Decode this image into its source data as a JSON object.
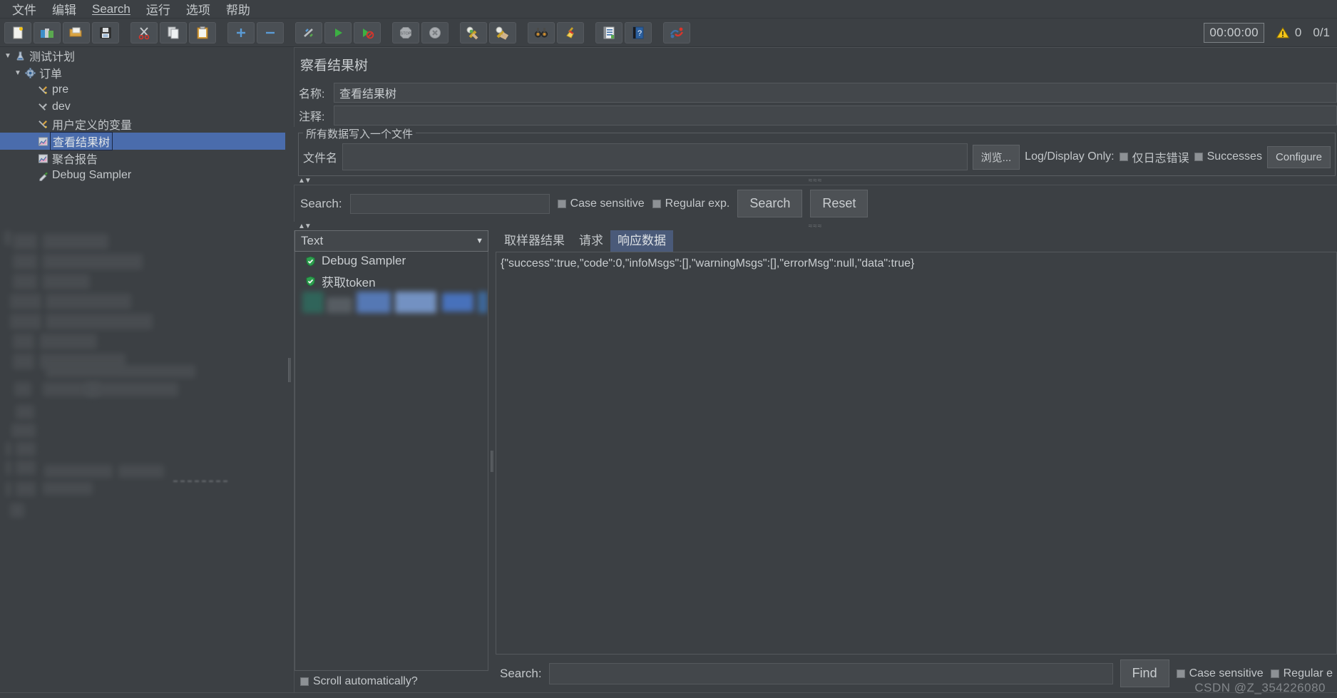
{
  "menu": {
    "items": [
      {
        "label": "文件",
        "name": "menu-file"
      },
      {
        "label": "编辑",
        "name": "menu-edit"
      },
      {
        "label": "Search",
        "name": "menu-search"
      },
      {
        "label": "运行",
        "name": "menu-run"
      },
      {
        "label": "选项",
        "name": "menu-options"
      },
      {
        "label": "帮助",
        "name": "menu-help"
      }
    ]
  },
  "toolbar": {
    "buttons": [
      {
        "icon": "new-file-icon"
      },
      {
        "icon": "templates-icon"
      },
      {
        "icon": "open-folder-icon"
      },
      {
        "icon": "save-icon"
      },
      {
        "icon": "cut-scissors-icon"
      },
      {
        "icon": "copy-icon"
      },
      {
        "icon": "paste-clipboard-icon"
      },
      {
        "icon": "expand-plus-icon"
      },
      {
        "icon": "collapse-minus-icon"
      },
      {
        "icon": "toggle-enable-icon"
      },
      {
        "icon": "start-play-icon"
      },
      {
        "icon": "start-no-timers-icon"
      },
      {
        "icon": "stop-icon"
      },
      {
        "icon": "shutdown-icon"
      },
      {
        "icon": "clear-icon"
      },
      {
        "icon": "clear-all-icon"
      },
      {
        "icon": "search-binoculars-icon"
      },
      {
        "icon": "reset-search-broom-icon"
      },
      {
        "icon": "function-helper-icon"
      },
      {
        "icon": "help-book-icon"
      },
      {
        "icon": "undo-redo-icon"
      }
    ],
    "timer": "00:00:00",
    "warning_count": "0",
    "thread_count": "0/1"
  },
  "tree": {
    "nodes": [
      {
        "label": "测试计划",
        "icon": "test-plan-icon",
        "depth": 0,
        "toggle": "▼",
        "selected": false,
        "name": "tree-node-test-plan"
      },
      {
        "label": "订单",
        "icon": "thread-group-icon",
        "depth": 1,
        "toggle": "▼",
        "selected": false,
        "name": "tree-node-order"
      },
      {
        "label": "pre",
        "icon": "config-element-icon",
        "depth": 2,
        "toggle": "",
        "selected": false,
        "name": "tree-node-pre"
      },
      {
        "label": "dev",
        "icon": "config-element-icon",
        "depth": 2,
        "toggle": "",
        "selected": false,
        "name": "tree-node-dev"
      },
      {
        "label": "用户定义的变量",
        "icon": "config-element-icon",
        "depth": 2,
        "toggle": "",
        "selected": false,
        "name": "tree-node-user-defined-variables"
      },
      {
        "label": "查看结果树",
        "icon": "listener-icon",
        "depth": 2,
        "toggle": "",
        "selected": true,
        "name": "tree-node-view-results-tree"
      },
      {
        "label": "聚合报告",
        "icon": "listener-icon",
        "depth": 2,
        "toggle": "",
        "selected": false,
        "name": "tree-node-aggregate-report"
      },
      {
        "label": "Debug Sampler",
        "icon": "sampler-icon",
        "depth": 2,
        "toggle": "",
        "selected": false,
        "name": "tree-node-debug-sampler"
      }
    ]
  },
  "panel": {
    "title": "察看结果树",
    "name_label": "名称:",
    "name_value": "查看结果树",
    "comment_label": "注释:",
    "comment_value": "",
    "groupbox_title": "所有数据写入一个文件",
    "filename_label": "文件名",
    "filename_value": "",
    "browse_button": "浏览...",
    "log_display_only_label": "Log/Display Only:",
    "errors_only_label": "仅日志错误",
    "successes_label": "Successes",
    "configure_button": "Configure"
  },
  "search": {
    "label": "Search:",
    "value": "",
    "case_sensitive_label": "Case sensitive",
    "regular_exp_label": "Regular exp.",
    "search_button": "Search",
    "reset_button": "Reset"
  },
  "results": {
    "render_selector_value": "Text",
    "items": [
      {
        "label": "Debug Sampler",
        "status": "success",
        "name": "result-item-debug-sampler"
      },
      {
        "label": "获取token",
        "status": "success",
        "name": "result-item-get-token"
      }
    ],
    "scroll_automatically_label": "Scroll automatically?"
  },
  "response": {
    "tabs": [
      {
        "label": "取样器结果",
        "active": false,
        "name": "tab-sampler-result"
      },
      {
        "label": "请求",
        "active": false,
        "name": "tab-request"
      },
      {
        "label": "响应数据",
        "active": true,
        "name": "tab-response-data"
      }
    ],
    "body_text": "{\"success\":true,\"code\":0,\"infoMsgs\":[],\"warningMsgs\":[],\"errorMsg\":null,\"data\":true}"
  },
  "bottom_search": {
    "label": "Search:",
    "value": "",
    "find_button": "Find",
    "case_sensitive_label": "Case sensitive",
    "regular_exp_label": "Regular e"
  },
  "watermark": "CSDN @Z_354226080",
  "colors": {
    "background": "#3c4044",
    "selection": "#4a6cac",
    "tab_active": "#4a5a79",
    "text": "#c3c7ca",
    "warning": "#ffcc33",
    "success": "#2e9e4f"
  }
}
